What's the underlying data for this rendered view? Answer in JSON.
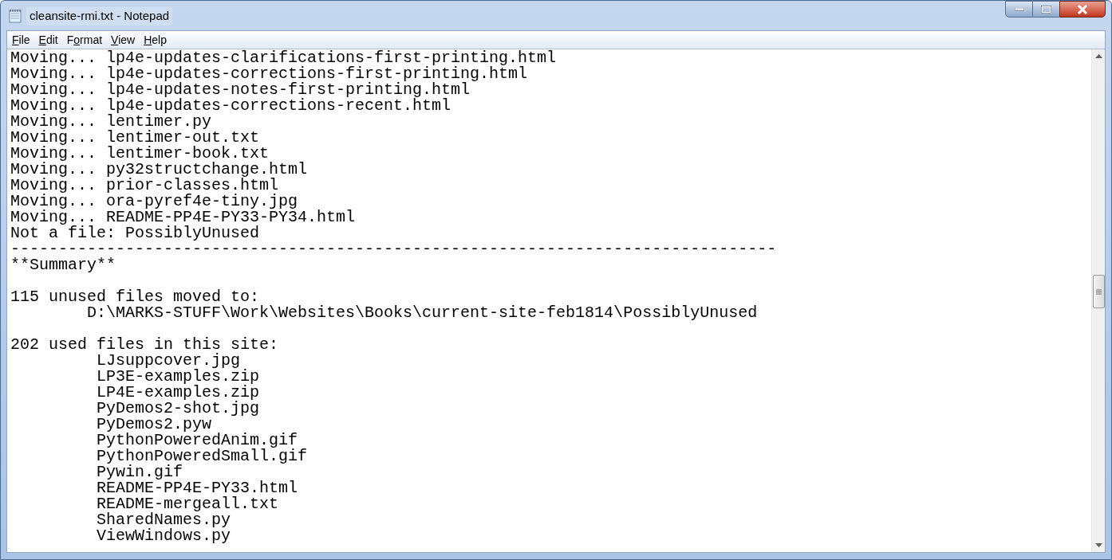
{
  "window": {
    "title": "cleansite-rmi.txt - Notepad"
  },
  "menu": [
    {
      "label": [
        {
          "text": "F",
          "underline": true
        },
        {
          "text": "ile",
          "underline": false
        }
      ]
    },
    {
      "label": [
        {
          "text": "E",
          "underline": true
        },
        {
          "text": "dit",
          "underline": false
        }
      ]
    },
    {
      "label": [
        {
          "text": "F",
          "underline": false
        },
        {
          "text": "o",
          "underline": true
        },
        {
          "text": "rmat",
          "underline": false
        }
      ]
    },
    {
      "label": [
        {
          "text": "V",
          "underline": true
        },
        {
          "text": "iew",
          "underline": false
        }
      ]
    },
    {
      "label": [
        {
          "text": "H",
          "underline": true
        },
        {
          "text": "elp",
          "underline": false
        }
      ]
    }
  ],
  "editor": {
    "lines": [
      {
        "kind": "text",
        "text": "Moving... lp4e-updates-clarifications-first-printing.html"
      },
      {
        "kind": "text",
        "text": "Moving... lp4e-updates-corrections-first-printing.html"
      },
      {
        "kind": "text",
        "text": "Moving... lp4e-updates-notes-first-printing.html"
      },
      {
        "kind": "text",
        "text": "Moving... lp4e-updates-corrections-recent.html"
      },
      {
        "kind": "text",
        "text": "Moving... lentimer.py"
      },
      {
        "kind": "text",
        "text": "Moving... lentimer-out.txt"
      },
      {
        "kind": "text",
        "text": "Moving... lentimer-book.txt"
      },
      {
        "kind": "text",
        "text": "Moving... py32structchange.html"
      },
      {
        "kind": "text",
        "text": "Moving... prior-classes.html"
      },
      {
        "kind": "text",
        "text": "Moving... ora-pyref4e-tiny.jpg"
      },
      {
        "kind": "text",
        "text": "Moving... README-PP4E-PY33-PY34.html"
      },
      {
        "kind": "text",
        "text": "Not a file: PossiblyUnused"
      },
      {
        "kind": "text",
        "text": "--------------------------------------------------------------------------------"
      },
      {
        "kind": "text",
        "text": "**Summary**"
      },
      {
        "kind": "blank"
      },
      {
        "kind": "text",
        "text": "115 unused files moved to:"
      },
      {
        "kind": "text",
        "text": "        D:\\MARKS-STUFF\\Work\\Websites\\Books\\current-site-feb1814\\PossiblyUnused"
      },
      {
        "kind": "blank"
      },
      {
        "kind": "text",
        "text": "202 used files in this site:"
      },
      {
        "kind": "text",
        "text": "         LJsuppcover.jpg"
      },
      {
        "kind": "text",
        "text": "         LP3E-examples.zip"
      },
      {
        "kind": "text",
        "text": "         LP4E-examples.zip"
      },
      {
        "kind": "text",
        "text": "         PyDemos2-shot.jpg"
      },
      {
        "kind": "text",
        "text": "         PyDemos2.pyw"
      },
      {
        "kind": "text",
        "text": "         PythonPoweredAnim.gif"
      },
      {
        "kind": "text",
        "text": "         PythonPoweredSmall.gif"
      },
      {
        "kind": "text",
        "text": "         Pywin.gif"
      },
      {
        "kind": "text",
        "text": "         README-PP4E-PY33.html"
      },
      {
        "kind": "text",
        "text": "         README-mergeall.txt"
      },
      {
        "kind": "text",
        "text": "         SharedNames.py"
      },
      {
        "kind": "text",
        "text": "         ViewWindows.py"
      }
    ]
  }
}
